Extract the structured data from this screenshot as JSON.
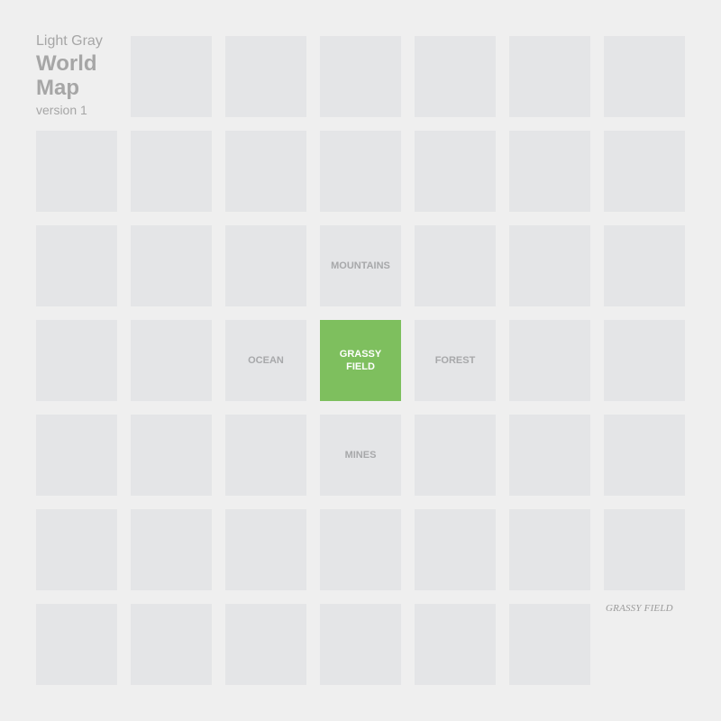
{
  "title": {
    "line_small": "Light Gray",
    "line_big_1": "World",
    "line_big_2": "Map",
    "version": "version 1"
  },
  "colors": {
    "background": "#efefef",
    "tile": "#e4e5e7",
    "tile_label": "#a7a8aa",
    "current_tile": "#7ebf5e",
    "current_label": "#ffffff"
  },
  "current_location": "GRASSY FIELD",
  "grid": {
    "rows": [
      [
        null,
        "",
        "",
        "",
        "",
        "",
        ""
      ],
      [
        "",
        "",
        "",
        "",
        "",
        "",
        ""
      ],
      [
        "",
        "",
        "",
        "MOUNTAINS",
        "",
        "",
        ""
      ],
      [
        "",
        "",
        "OCEAN",
        "GRASSY\nFIELD",
        "FOREST",
        "",
        ""
      ],
      [
        "",
        "",
        "",
        "MINES",
        "",
        "",
        ""
      ],
      [
        "",
        "",
        "",
        "",
        "",
        "",
        ""
      ],
      [
        "",
        "",
        "",
        "",
        "",
        "",
        null
      ]
    ],
    "current": {
      "row": 3,
      "col": 3
    }
  }
}
